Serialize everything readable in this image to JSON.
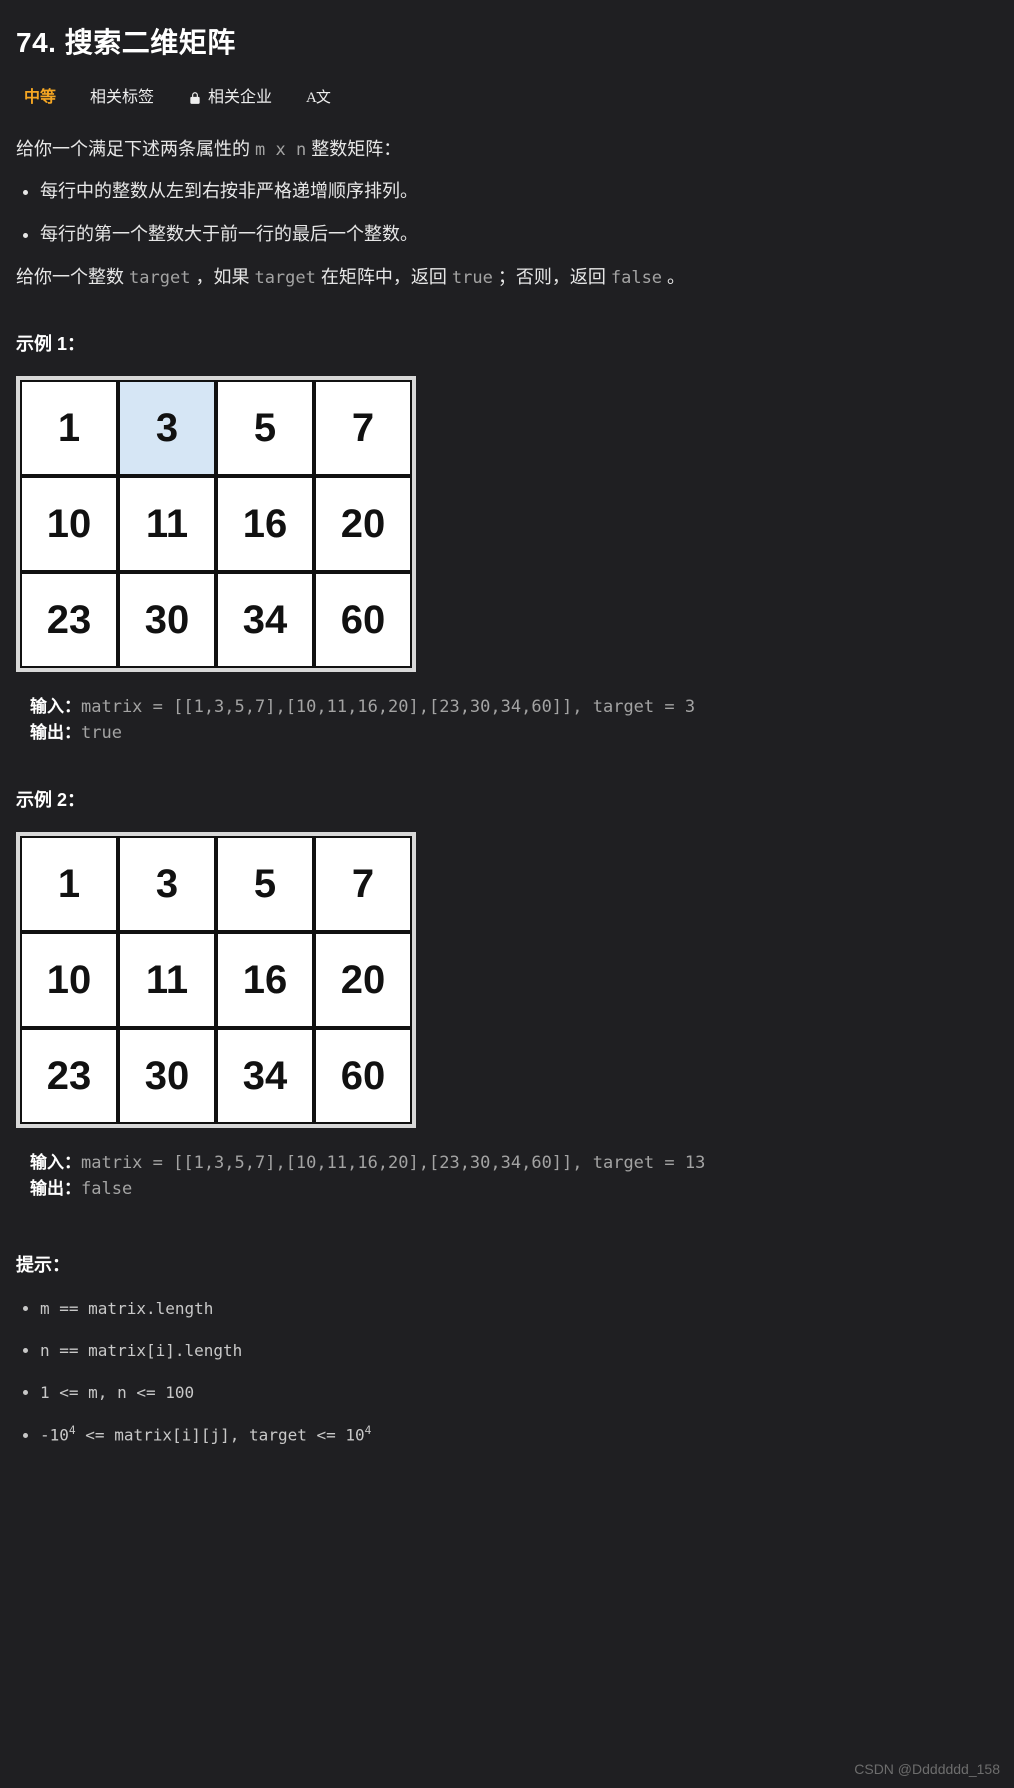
{
  "title": "74. 搜索二维矩阵",
  "tabs": {
    "difficulty": "中等",
    "tags": "相关标签",
    "companies": "相关企业",
    "translate": "A文"
  },
  "desc": {
    "p1_a": "给你一个满足下述两条属性的 ",
    "p1_code": "m x n",
    "p1_b": " 整数矩阵：",
    "li1": "每行中的整数从左到右按非严格递增顺序排列。",
    "li2": "每行的第一个整数大于前一行的最后一个整数。",
    "p2_a": "给你一个整数 ",
    "p2_c1": "target",
    "p2_b": " ，如果 ",
    "p2_c2": "target",
    "p2_c": " 在矩阵中，返回 ",
    "p2_c3": "true",
    "p2_d": " ；否则，返回 ",
    "p2_c4": "false",
    "p2_e": " 。"
  },
  "example1": {
    "heading": "示例 1：",
    "highlight": [
      0,
      1
    ],
    "input_label": "输入：",
    "input_val": "matrix = [[1,3,5,7],[10,11,16,20],[23,30,34,60]], target = 3",
    "output_label": "输出：",
    "output_val": "true"
  },
  "example2": {
    "heading": "示例 2：",
    "input_label": "输入：",
    "input_val": "matrix = [[1,3,5,7],[10,11,16,20],[23,30,34,60]], target = 13",
    "output_label": "输出：",
    "output_val": "false"
  },
  "matrix_data": [
    [
      1,
      3,
      5,
      7
    ],
    [
      10,
      11,
      16,
      20
    ],
    [
      23,
      30,
      34,
      60
    ]
  ],
  "hints": {
    "heading": "提示：",
    "items_html": [
      "m == matrix.length",
      "n == matrix[i].length",
      "1 <= m, n <= 100",
      "-10<sup>4</sup> <= matrix[i][j], target <= 10<sup>4</sup>"
    ]
  },
  "watermark": "CSDN @Ddddddd_158"
}
